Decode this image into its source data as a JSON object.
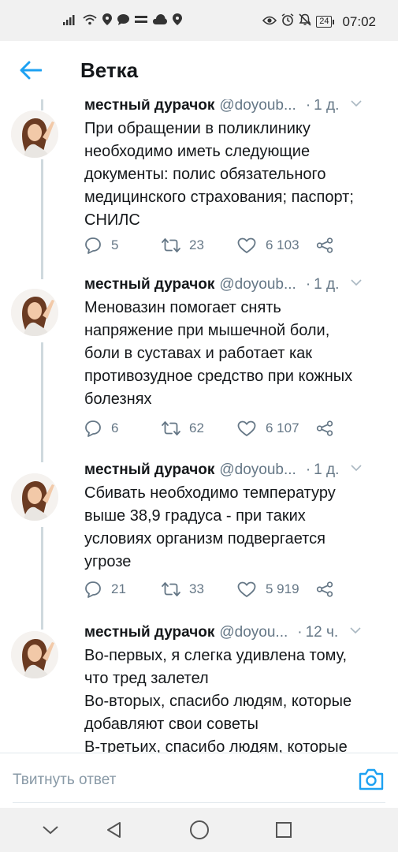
{
  "status_bar": {
    "time": "07:02",
    "battery": "24",
    "left_icons": [
      "signal-icon",
      "wifi-icon",
      "location-icon",
      "message-icon",
      "notification-icon",
      "cloud-icon",
      "location-icon"
    ],
    "right_icons": [
      "eye-icon",
      "alarm-icon",
      "mute-icon"
    ]
  },
  "header": {
    "title": "Ветка",
    "back_icon": "back-arrow-icon"
  },
  "colors": {
    "accent": "#1da1f2",
    "text": "#14171a",
    "secondary": "#657786",
    "thread_line": "#cfd9de"
  },
  "tweets": [
    {
      "author": "местный дурачок",
      "handle": "@doyoub...",
      "time": "1 д.",
      "lines": [
        "При обращении в поликлинику",
        "необходимо иметь следующие",
        "документы: полис обязательного",
        "медицинского страхования; паспорт;",
        "СНИЛС"
      ],
      "replies": "5",
      "retweets": "23",
      "likes": "6 103"
    },
    {
      "author": "местный дурачок",
      "handle": "@doyoub...",
      "time": "1 д.",
      "lines": [
        "Меновазин помогает снять",
        "напряжение при мышечной боли,",
        "боли в суставах и работает как",
        "противозудное средство при кожных",
        "болезнях"
      ],
      "replies": "6",
      "retweets": "62",
      "likes": "6 107"
    },
    {
      "author": "местный дурачок",
      "handle": "@doyoub...",
      "time": "1 д.",
      "lines": [
        "Сбивать необходимо температуру",
        "выше 38,9 градуса - при таких",
        "условиях организм подвергается",
        "угрозе"
      ],
      "replies": "21",
      "retweets": "33",
      "likes": "5 919"
    },
    {
      "author": "местный дурачок",
      "handle": "@doyou...",
      "time": "12 ч.",
      "lines": [
        "Во-первых, я слегка удивлена тому,",
        "что тред залетел",
        "Во-вторых, спасибо людям, которые",
        "добавляют свои советы",
        "В-третьих, спасибо людям, которые"
      ],
      "replies": "",
      "retweets": "",
      "likes": ""
    }
  ],
  "reply_bar": {
    "placeholder": "Твитнуть ответ",
    "camera_icon": "camera-icon"
  },
  "nav_bar": {
    "icons": [
      "chevron-down-icon",
      "back-triangle-icon",
      "home-circle-icon",
      "recents-square-icon"
    ]
  }
}
